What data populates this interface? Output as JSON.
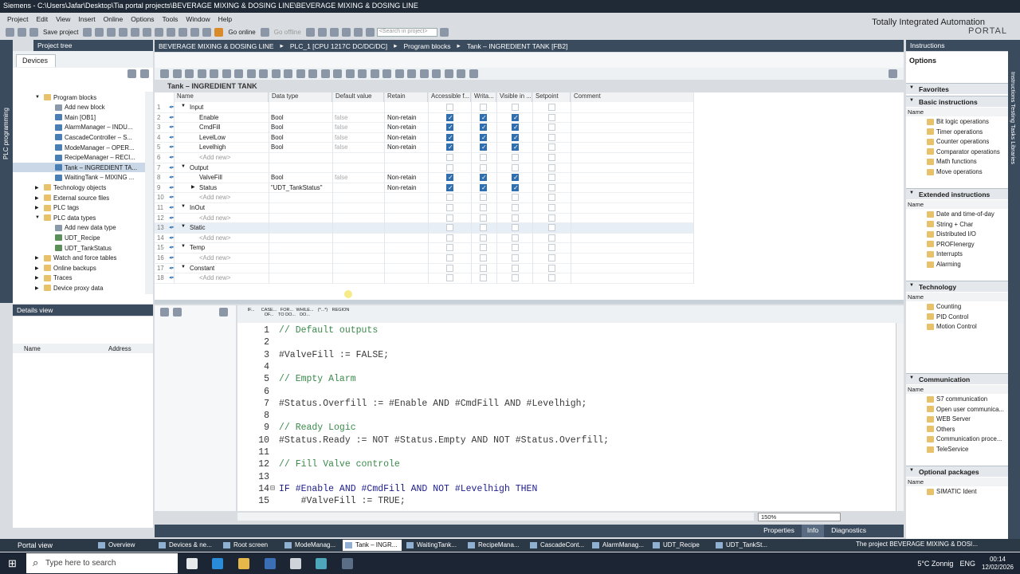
{
  "window_title": "Siemens  -  C:\\Users\\Jafar\\Desktop\\Tia portal projects\\BEVERAGE MIXING & DOSING LINE\\BEVERAGE MIXING & DOSING LINE",
  "menu": [
    "Project",
    "Edit",
    "View",
    "Insert",
    "Online",
    "Options",
    "Tools",
    "Window",
    "Help"
  ],
  "brand": {
    "line1": "Totally Integrated Automation",
    "line2": "PORTAL"
  },
  "toolbar": {
    "save": "Save project",
    "go_online": "Go online",
    "go_offline": "Go offline",
    "search_placeholder": "<Search in project>"
  },
  "project_tree": {
    "header": "Project tree",
    "vertical_label": "PLC programming",
    "devices_tab": "Devices",
    "items": [
      {
        "label": "Program blocks",
        "icon": "folder"
      },
      {
        "label": "Add new block",
        "icon": "add"
      },
      {
        "label": "Main [OB1]",
        "icon": "block"
      },
      {
        "label": "AlarmManager – INDU...",
        "icon": "block"
      },
      {
        "label": "CascadeController – S...",
        "icon": "block"
      },
      {
        "label": "ModeManager – OPER...",
        "icon": "block"
      },
      {
        "label": "RecipeManager – RECI...",
        "icon": "block"
      },
      {
        "label": "Tank – INGREDIENT TA...",
        "icon": "block"
      },
      {
        "label": "WaitingTank – MIXING ...",
        "icon": "block"
      },
      {
        "label": "Technology objects",
        "icon": "folder"
      },
      {
        "label": "External source files",
        "icon": "folder"
      },
      {
        "label": "PLC tags",
        "icon": "folder"
      },
      {
        "label": "PLC data types",
        "icon": "folder"
      },
      {
        "label": "Add new data type",
        "icon": "add"
      },
      {
        "label": "UDT_Recipe",
        "icon": "datatype"
      },
      {
        "label": "UDT_TankStatus",
        "icon": "datatype"
      },
      {
        "label": "Watch and force tables",
        "icon": "folder"
      },
      {
        "label": "Online backups",
        "icon": "folder"
      },
      {
        "label": "Traces",
        "icon": "folder"
      },
      {
        "label": "Device proxy data",
        "icon": "folder"
      }
    ]
  },
  "details": {
    "header": "Details view",
    "col_name": "Name",
    "col_address": "Address"
  },
  "breadcrumb": [
    "BEVERAGE MIXING & DOSING LINE",
    "PLC_1 [CPU 1217C DC/DC/DC]",
    "Program blocks",
    "Tank – INGREDIENT TANK [FB2]"
  ],
  "block_title": "Tank – INGREDIENT TANK",
  "interface": {
    "columns": [
      "Name",
      "Data type",
      "Default value",
      "Retain",
      "Accessible f...",
      "Writa...",
      "Visible in ...",
      "Setpoint",
      "Comment"
    ],
    "rows": [
      {
        "n": "1",
        "name": "Input",
        "section": true
      },
      {
        "n": "2",
        "name": "Enable",
        "type": "Bool",
        "def": "false",
        "ret": "Non-retain",
        "a": true,
        "w": true,
        "v": true
      },
      {
        "n": "3",
        "name": "CmdFill",
        "type": "Bool",
        "def": "false",
        "ret": "Non-retain",
        "a": true,
        "w": true,
        "v": true
      },
      {
        "n": "4",
        "name": "LevelLow",
        "type": "Bool",
        "def": "false",
        "ret": "Non-retain",
        "a": true,
        "w": true,
        "v": true
      },
      {
        "n": "5",
        "name": "Levelhigh",
        "type": "Bool",
        "def": "false",
        "ret": "Non-retain",
        "a": true,
        "w": true,
        "v": true
      },
      {
        "n": "6",
        "name": "<Add new>",
        "add": true
      },
      {
        "n": "7",
        "name": "Output",
        "section": true
      },
      {
        "n": "8",
        "name": "ValveFill",
        "type": "Bool",
        "def": "false",
        "ret": "Non-retain",
        "a": true,
        "w": true,
        "v": true
      },
      {
        "n": "9",
        "name": "Status",
        "type": "\"UDT_TankStatus\"",
        "def": "",
        "ret": "Non-retain",
        "a": true,
        "w": true,
        "v": true,
        "expand": true
      },
      {
        "n": "10",
        "name": "<Add new>",
        "add": true
      },
      {
        "n": "11",
        "name": "InOut",
        "section": true
      },
      {
        "n": "12",
        "name": "<Add new>",
        "add": true
      },
      {
        "n": "13",
        "name": "Static",
        "section": true
      },
      {
        "n": "14",
        "name": "<Add new>",
        "add": true
      },
      {
        "n": "15",
        "name": "Temp",
        "section": true
      },
      {
        "n": "16",
        "name": "<Add new>",
        "add": true
      },
      {
        "n": "17",
        "name": "Constant",
        "section": true
      },
      {
        "n": "18",
        "name": "<Add new>",
        "add": true
      }
    ]
  },
  "scl_toolbar": [
    "IF...",
    "CASE... OF...",
    "FOR... TO DO...",
    "WHILE... DO...",
    "(*...*)",
    "REGION"
  ],
  "code": [
    {
      "n": "1",
      "t": "// Default outputs",
      "c": "cm"
    },
    {
      "n": "2",
      "t": "",
      "c": "tx"
    },
    {
      "n": "3",
      "t": "#ValveFill := FALSE;",
      "c": "tx"
    },
    {
      "n": "4",
      "t": "",
      "c": "tx"
    },
    {
      "n": "5",
      "t": "// Empty Alarm",
      "c": "cm"
    },
    {
      "n": "6",
      "t": "",
      "c": "tx"
    },
    {
      "n": "7",
      "t": "#Status.Overfill := #Enable AND #CmdFill AND #Levelhigh;",
      "c": "tx"
    },
    {
      "n": "8",
      "t": "",
      "c": "tx"
    },
    {
      "n": "9",
      "t": "// Ready Logic",
      "c": "cm"
    },
    {
      "n": "10",
      "t": "#Status.Ready := NOT #Status.Empty AND NOT #Status.Overfill;",
      "c": "tx"
    },
    {
      "n": "11",
      "t": "",
      "c": "tx"
    },
    {
      "n": "12",
      "t": "// Fill Valve controle",
      "c": "cm"
    },
    {
      "n": "13",
      "t": "",
      "c": "tx"
    },
    {
      "n": "14",
      "t": "IF #Enable AND #CmdFill AND NOT #Levelhigh THEN",
      "c": "kw"
    },
    {
      "n": "15",
      "t": "    #ValveFill := TRUE;",
      "c": "tx"
    }
  ],
  "zoom": "150%",
  "inspector_tabs": [
    "Properties",
    "Info",
    "Diagnostics"
  ],
  "instructions": {
    "header": "Instructions",
    "options": "Options",
    "vertical_label": "Instructions   Testing   Tasks   Libraries",
    "favorites": "Favorites",
    "basic": {
      "title": "Basic instructions",
      "name_col": "Name",
      "items": [
        "Bit logic operations",
        "Timer operations",
        "Counter operations",
        "Comparator operations",
        "Math functions",
        "Move operations"
      ]
    },
    "extended": {
      "title": "Extended instructions",
      "name_col": "Name",
      "items": [
        "Date and time-of-day",
        "String + Char",
        "Distributed I/O",
        "PROFIenergy",
        "Interrupts",
        "Alarming"
      ]
    },
    "technology": {
      "title": "Technology",
      "name_col": "Name",
      "items": [
        "Counting",
        "PID Control",
        "Motion Control"
      ]
    },
    "communication": {
      "title": "Communication",
      "name_col": "Name",
      "items": [
        "S7 communication",
        "Open user communica...",
        "WEB Server",
        "Others",
        "Communication proce...",
        "TeleService"
      ]
    },
    "optional": {
      "title": "Optional packages",
      "name_col": "Name",
      "items": [
        "SIMATIC Ident"
      ]
    }
  },
  "portal_bar": {
    "portal_view": "Portal view",
    "tabs": [
      "Overview",
      "Devices & ne...",
      "Root screen",
      "ModeManag...",
      "Tank – INGR...",
      "WaitingTank...",
      "RecipeMana...",
      "CascadeCont...",
      "AlarmManag...",
      "UDT_Recipe",
      "UDT_TankSt..."
    ],
    "active": 4,
    "status": "The project BEVERAGE MIXING & DOSI..."
  },
  "taskbar": {
    "search": "Type here to search",
    "weather": "5°C  Zonnig",
    "lang": "ENG",
    "time": "00:14",
    "date": "12/02/2026"
  }
}
